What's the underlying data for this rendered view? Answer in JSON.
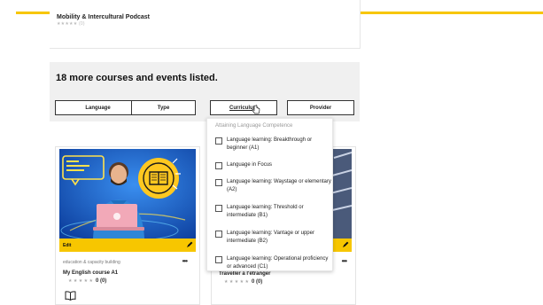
{
  "previous_card": {
    "title": "Mobility & Intercultural Podcast",
    "stars": "★★★★★",
    "count": "(0)"
  },
  "filters": {
    "heading": "18 more courses and events listed.",
    "buttons": [
      {
        "label": "Language"
      },
      {
        "label": "Type"
      },
      {
        "label": "Curriculum"
      },
      {
        "label": "Provider"
      }
    ]
  },
  "dropdown": {
    "heading": "Attaining Language Competence",
    "items": [
      {
        "label": "Language learning: Breakthrough or beginner (A1)"
      },
      {
        "label": "Language in Focus"
      },
      {
        "label": "Language learning: Waystage or elementary (A2)"
      },
      {
        "label": "Language learning: Threshold or intermediate (B1)"
      },
      {
        "label": "Language learning: Vantage or upper intermediate (B2)"
      },
      {
        "label": "Language learning: Operational proficiency or advanced (C1)"
      }
    ]
  },
  "cards": [
    {
      "edit_label": "Edit",
      "category": "education & capacity building",
      "more": "•••",
      "title": "My English course A1",
      "stars": "★ ★ ★ ★ ★",
      "rating": "0 (0)"
    },
    {
      "more": "•••",
      "title": "Traveller à l'étranger",
      "stars": "★ ★ ★ ★ ★",
      "rating": "0 (0)"
    }
  ],
  "colors": {
    "accent": "#f7c600",
    "image_background": "#2a6dd8"
  }
}
